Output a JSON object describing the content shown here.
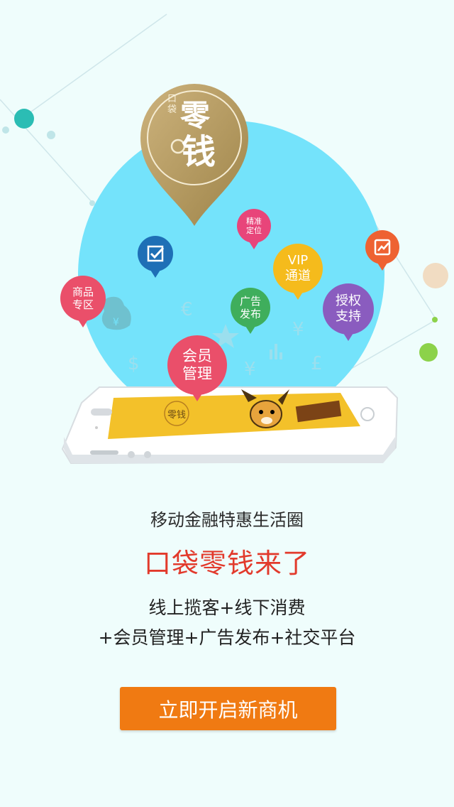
{
  "logo": {
    "small_text": "口袋",
    "big_char_1": "零",
    "big_char_2": "钱"
  },
  "pins": {
    "product_zone": "商品\n专区",
    "precise_location": "精准\n定位",
    "vip_channel": "VIP\n通道",
    "ad_publish": "广告\n发布",
    "authorization": "授权\n支持",
    "member_management": "会员\n管理"
  },
  "icons": {
    "checkbox": "checkbox-icon",
    "chart": "trend-chart-icon"
  },
  "colors": {
    "background": "#effdfc",
    "circle": "#74e3fb",
    "accent": "#f07a12",
    "headline": "#e23a2c"
  },
  "content": {
    "tagline": "移动金融特惠生活圈",
    "headline": "口袋零钱来了",
    "line1": "线上揽客+线下消费",
    "line2": "+会员管理+广告发布+社交平台",
    "cta": "立即开启新商机"
  }
}
